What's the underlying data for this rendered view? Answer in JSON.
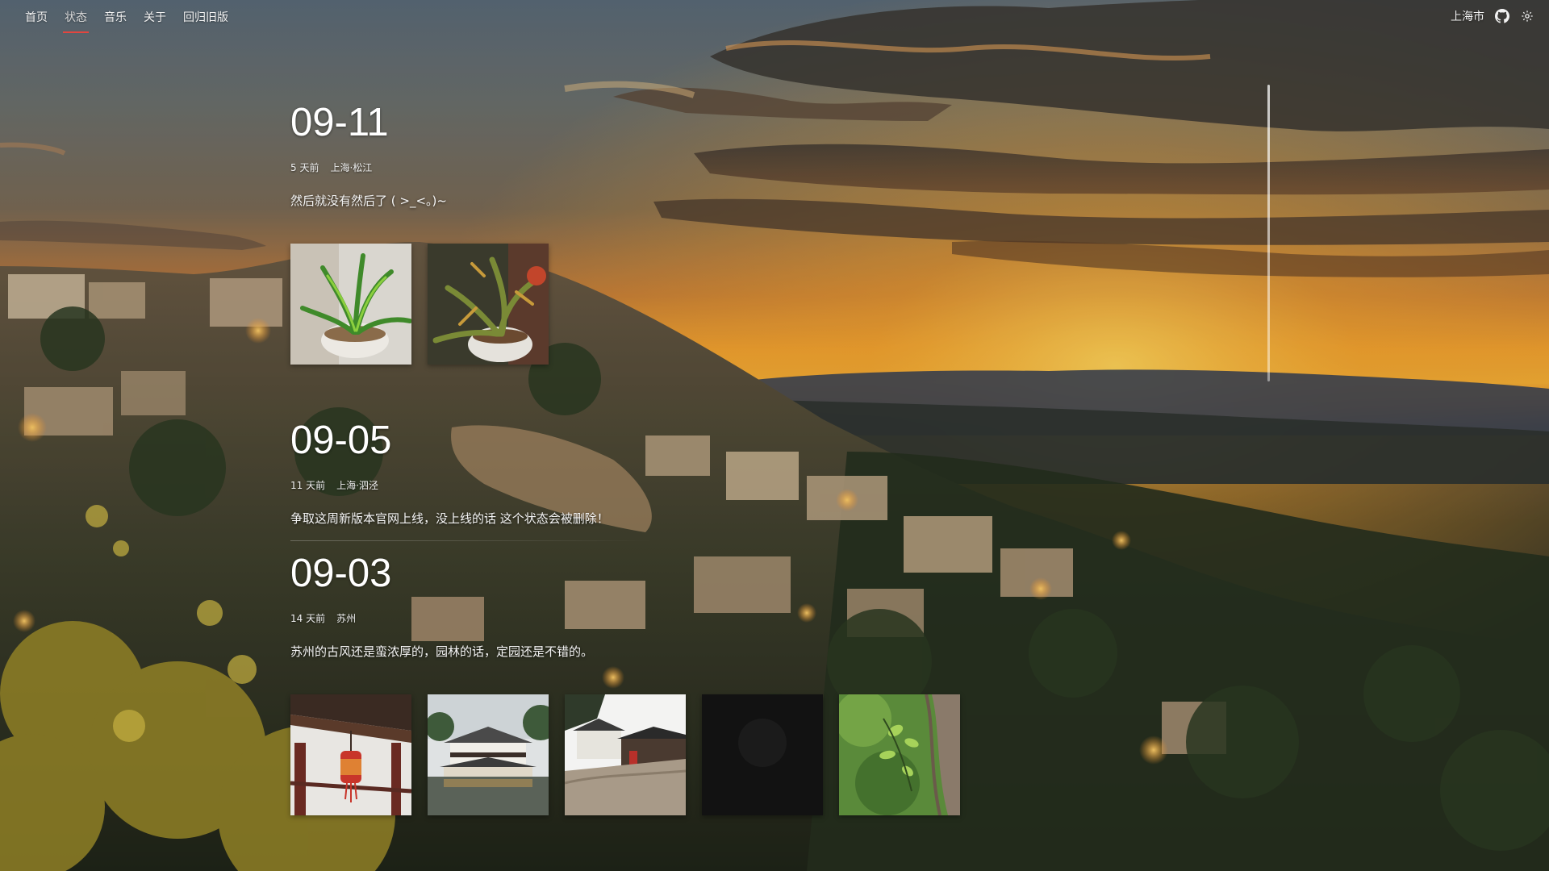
{
  "nav": {
    "items": [
      {
        "label": "首页",
        "active": false
      },
      {
        "label": "状态",
        "active": true
      },
      {
        "label": "音乐",
        "active": false
      },
      {
        "label": "关于",
        "active": false
      },
      {
        "label": "回归旧版",
        "active": false
      }
    ],
    "city": "上海市",
    "icons": [
      "github-icon",
      "settings-icon"
    ],
    "accent_color": "#e2463f"
  },
  "posts": [
    {
      "date": "09-11",
      "ago": "5 天前",
      "location": "上海·松江",
      "text": "然后就没有然后了 ( >_<。)~",
      "photos": [
        "potted-plant-photo",
        "potted-plant-closeup-photo"
      ]
    },
    {
      "date": "09-05",
      "ago": "11 天前",
      "location": "上海·泗泾",
      "text": "争取这周新版本官网上线，没上线的话 这个状态会被删除！",
      "photos": []
    },
    {
      "date": "09-03",
      "ago": "14 天前",
      "location": "苏州",
      "text": "苏州的古风还是蛮浓厚的，园林的话，定园还是不错的。",
      "photos": [
        "lantern-eaves-photo",
        "garden-pavilion-photo",
        "courtyard-photo",
        "dark-photo",
        "green-leaves-photo"
      ]
    }
  ]
}
